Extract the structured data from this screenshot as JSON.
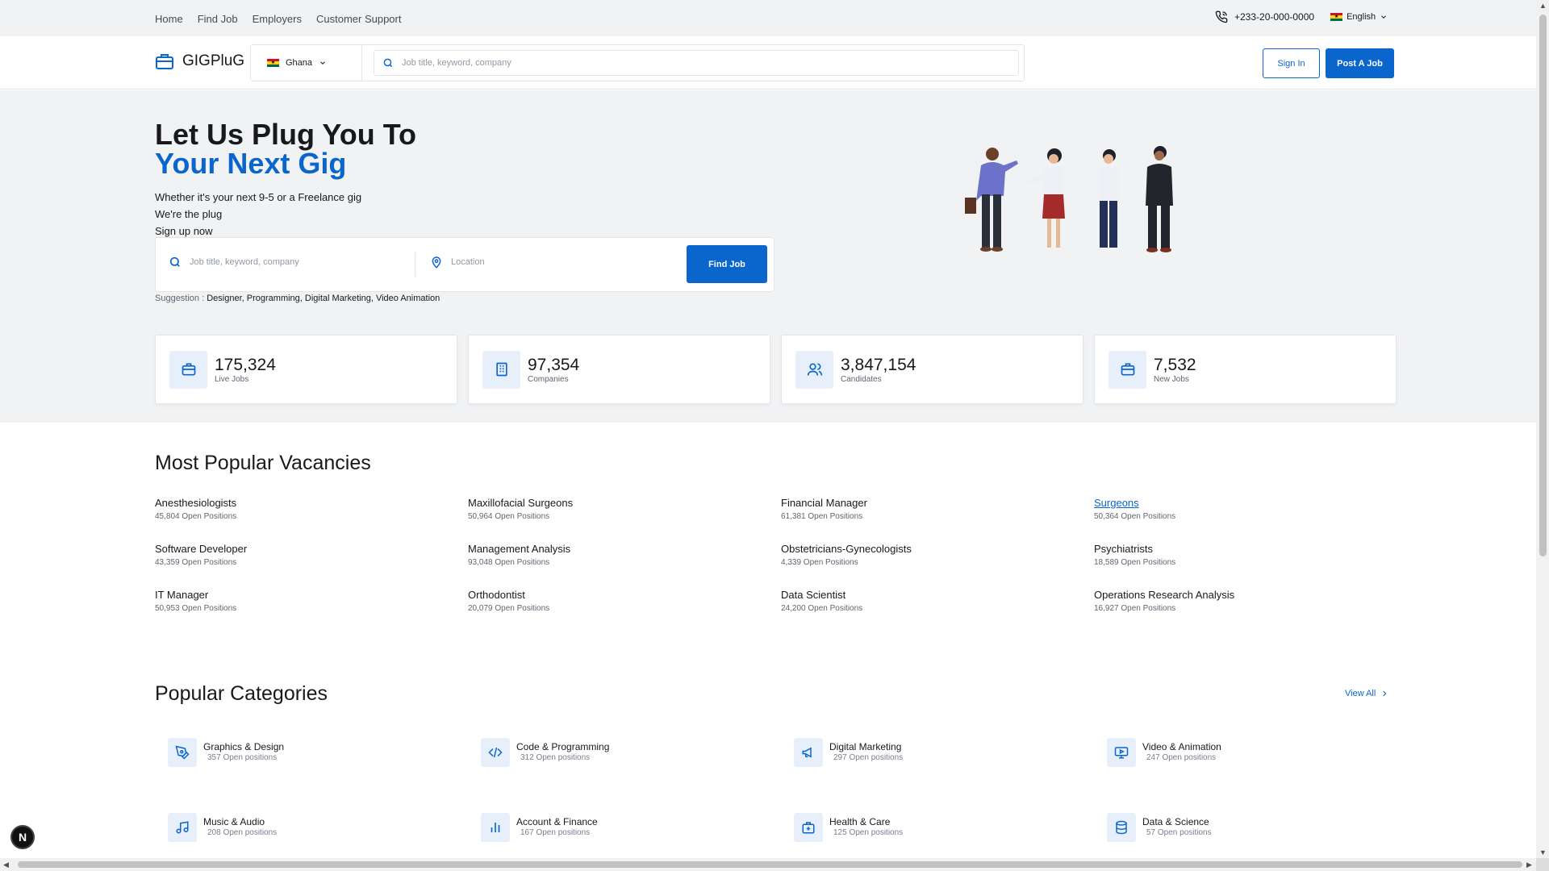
{
  "topbar": {
    "nav": [
      "Home",
      "Find Job",
      "Employers",
      "Customer Support"
    ],
    "phone": "+233-20-000-0000",
    "language": "English"
  },
  "header": {
    "logo": "GIGPluG",
    "country": "Ghana",
    "search_placeholder": "Job title, keyword, company",
    "sign_in": "Sign In",
    "post_job": "Post A Job"
  },
  "hero": {
    "title_line1": "Let Us Plug You To",
    "title_line2": "Your Next Gig",
    "sub1": "Whether it's your next 9-5 or a Freelance gig",
    "sub2": "We're the plug",
    "sub3": "Sign up now",
    "search_placeholder": "Job title, keyword, company",
    "location_placeholder": "Location",
    "find_button": "Find Job",
    "suggestion_label": "Suggestion :",
    "suggestions": [
      "Designer,",
      "Programming,",
      "Digital Marketing,",
      "Video Animation"
    ]
  },
  "stats": [
    {
      "value": "175,324",
      "label": "Live Jobs",
      "icon": "briefcase-icon"
    },
    {
      "value": "97,354",
      "label": "Companies",
      "icon": "building-icon"
    },
    {
      "value": "3,847,154",
      "label": "Candidates",
      "icon": "users-icon"
    },
    {
      "value": "7,532",
      "label": "New Jobs",
      "icon": "briefcase-icon"
    }
  ],
  "vacancies": {
    "title": "Most Popular Vacancies",
    "items": [
      {
        "title": "Anesthesiologists",
        "positions": "45,804 Open Positions"
      },
      {
        "title": "Maxillofacial Surgeons",
        "positions": "50,964 Open Positions"
      },
      {
        "title": "Financial Manager",
        "positions": "61,381 Open Positions"
      },
      {
        "title": "Surgeons",
        "positions": "50,364 Open Positions"
      },
      {
        "title": "Software Developer",
        "positions": "43,359 Open Positions"
      },
      {
        "title": "Management Analysis",
        "positions": "93,048 Open Positions"
      },
      {
        "title": "Obstetricians-Gynecologists",
        "positions": "4,339 Open Positions"
      },
      {
        "title": "Psychiatrists",
        "positions": "18,589 Open Positions"
      },
      {
        "title": "IT Manager",
        "positions": "50,953 Open Positions"
      },
      {
        "title": "Orthodontist",
        "positions": "20,079 Open Positions"
      },
      {
        "title": "Data Scientist",
        "positions": "24,200 Open Positions"
      },
      {
        "title": "Operations Research Analysis",
        "positions": "16,927 Open Positions"
      }
    ]
  },
  "categories": {
    "title": "Popular Categories",
    "view_all": "View All",
    "items": [
      {
        "title": "Graphics & Design",
        "positions": "357 Open positions",
        "icon": "pen-tool-icon"
      },
      {
        "title": "Code & Programming",
        "positions": "312 Open positions",
        "icon": "code-icon"
      },
      {
        "title": "Digital Marketing",
        "positions": "297 Open positions",
        "icon": "megaphone-icon"
      },
      {
        "title": "Video & Animation",
        "positions": "247 Open positions",
        "icon": "monitor-play-icon"
      },
      {
        "title": "Music & Audio",
        "positions": "208 Open positions",
        "icon": "music-note-icon"
      },
      {
        "title": "Account & Finance",
        "positions": "167 Open positions",
        "icon": "bar-chart-icon"
      },
      {
        "title": "Health & Care",
        "positions": "125 Open positions",
        "icon": "first-aid-icon"
      },
      {
        "title": "Data & Science",
        "positions": "57 Open positions",
        "icon": "database-icon"
      }
    ]
  },
  "badge": "N",
  "colors": {
    "primary": "#0a65cc",
    "light_bg": "#f1f2f4",
    "icon_bg": "#e7f0fa"
  }
}
